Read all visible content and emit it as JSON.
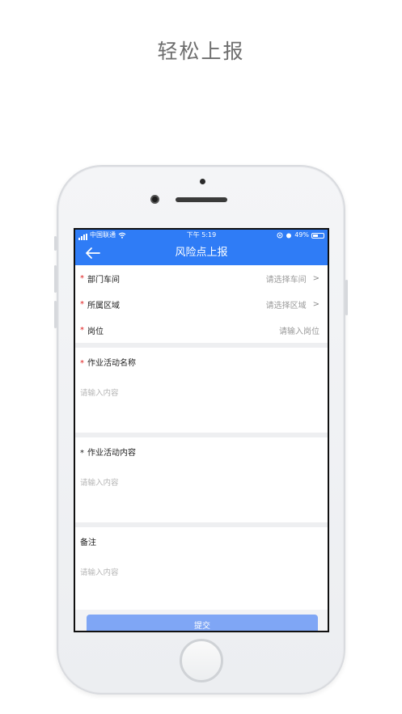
{
  "headline": "轻松上报",
  "status_bar": {
    "carrier": "中国联通",
    "time": "下午 5:19",
    "battery": "49%",
    "battery_level": 0.49
  },
  "nav": {
    "title": "风险点上报",
    "back_icon": "arrow-left-icon"
  },
  "form": {
    "rows": [
      {
        "required": "*",
        "label": "部门车间",
        "placeholder": "请选择车间",
        "chevron": ">"
      },
      {
        "required": "*",
        "label": "所属区域",
        "placeholder": "请选择区域",
        "chevron": ">"
      },
      {
        "required": "*",
        "label": "岗位",
        "placeholder": "请输入岗位"
      }
    ],
    "blocks": [
      {
        "required": "*",
        "title": "作业活动名称",
        "placeholder": "请输入内容"
      },
      {
        "required": "*",
        "title": "作业活动内容",
        "placeholder": "请输入内容"
      },
      {
        "title": "备注",
        "placeholder": "请输入内容"
      }
    ]
  },
  "submit_label": "提交",
  "colors": {
    "primary": "#2f7cf6",
    "submit": "#7fa6f5",
    "required": "#e02020"
  }
}
